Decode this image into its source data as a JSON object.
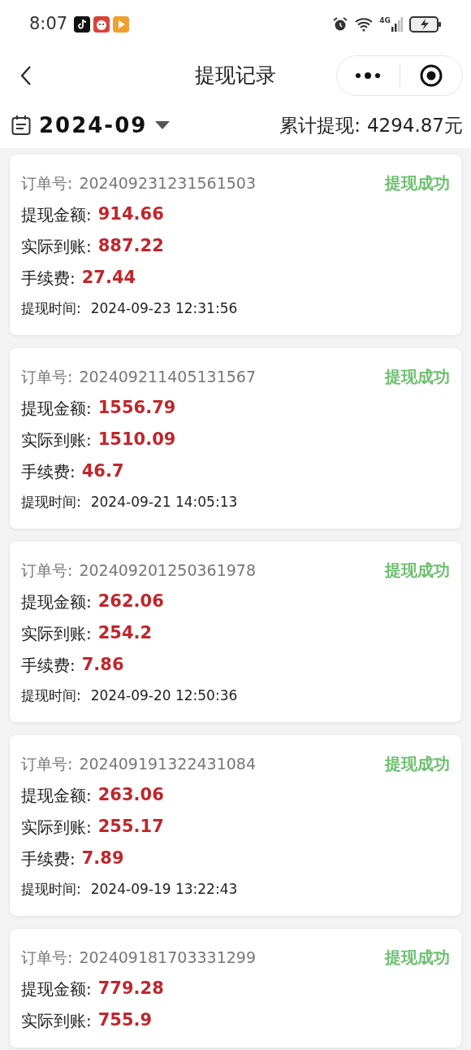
{
  "status_bar": {
    "time": "8:07",
    "network": "4G"
  },
  "nav": {
    "title": "提现记录"
  },
  "filter": {
    "month": "2024-09",
    "total_label": "累计提现:",
    "total_value": "4294.87元"
  },
  "records": [
    {
      "order_label": "订单号:",
      "order_no": "202409231231561503",
      "status": "提现成功",
      "fields": [
        {
          "label": "提现金额:",
          "value": "914.66"
        },
        {
          "label": "实际到账:",
          "value": "887.22"
        },
        {
          "label": "手续费:",
          "value": "27.44"
        }
      ],
      "time_label": "提现时间:",
      "time": "2024-09-23 12:31:56"
    },
    {
      "order_label": "订单号:",
      "order_no": "202409211405131567",
      "status": "提现成功",
      "fields": [
        {
          "label": "提现金额:",
          "value": "1556.79"
        },
        {
          "label": "实际到账:",
          "value": "1510.09"
        },
        {
          "label": "手续费:",
          "value": "46.7"
        }
      ],
      "time_label": "提现时间:",
      "time": "2024-09-21 14:05:13"
    },
    {
      "order_label": "订单号:",
      "order_no": "202409201250361978",
      "status": "提现成功",
      "fields": [
        {
          "label": "提现金额:",
          "value": "262.06"
        },
        {
          "label": "实际到账:",
          "value": "254.2"
        },
        {
          "label": "手续费:",
          "value": "7.86"
        }
      ],
      "time_label": "提现时间:",
      "time": "2024-09-20 12:50:36"
    },
    {
      "order_label": "订单号:",
      "order_no": "202409191322431084",
      "status": "提现成功",
      "fields": [
        {
          "label": "提现金额:",
          "value": "263.06"
        },
        {
          "label": "实际到账:",
          "value": "255.17"
        },
        {
          "label": "手续费:",
          "value": "7.89"
        }
      ],
      "time_label": "提现时间:",
      "time": "2024-09-19 13:22:43"
    },
    {
      "order_label": "订单号:",
      "order_no": "202409181703331299",
      "status": "提现成功",
      "fields": [
        {
          "label": "提现金额:",
          "value": "779.28"
        },
        {
          "label": "实际到账:",
          "value": "755.9"
        }
      ]
    }
  ]
}
